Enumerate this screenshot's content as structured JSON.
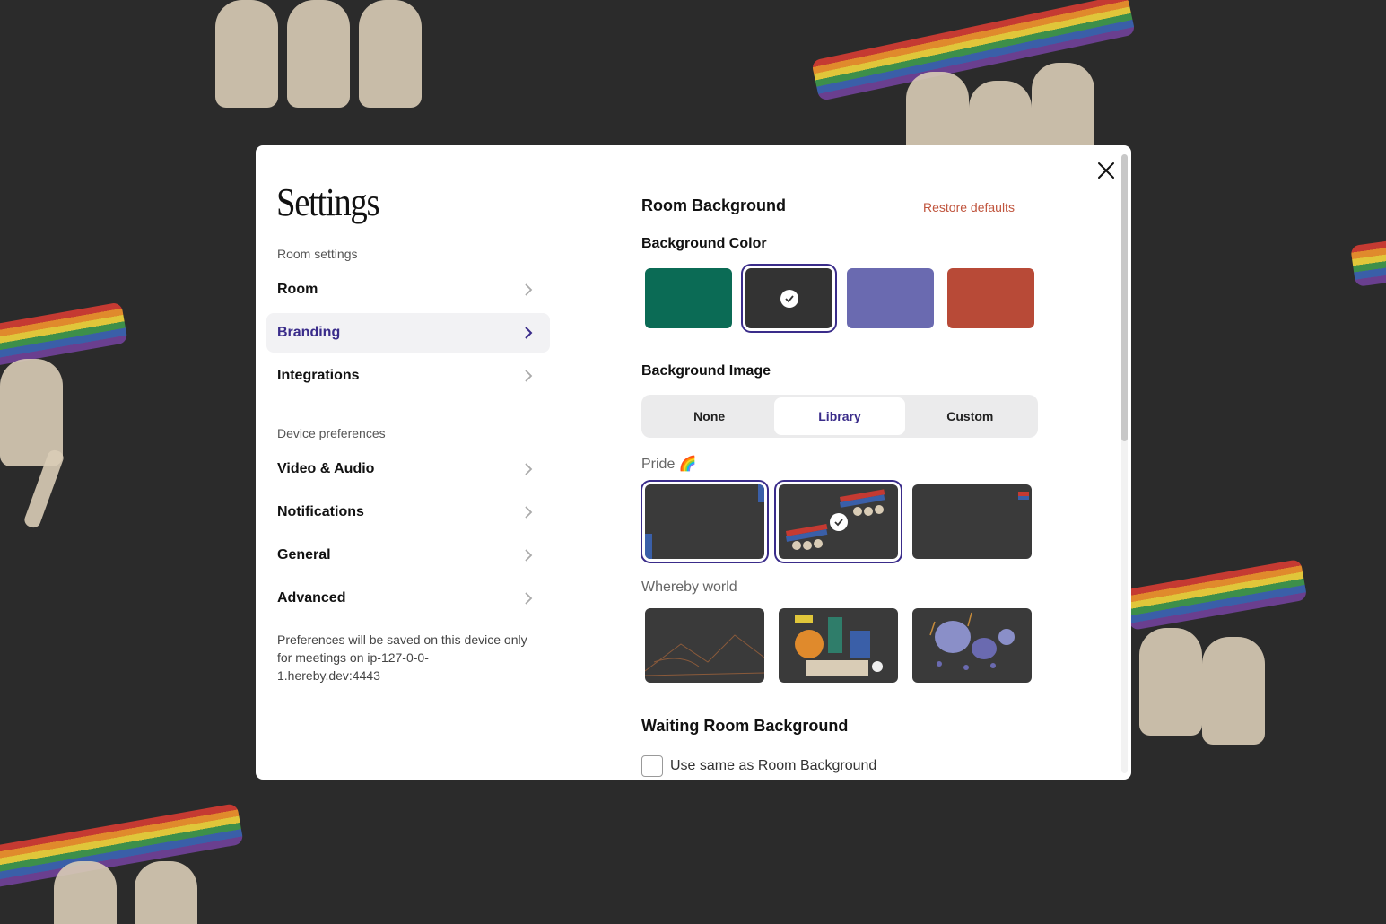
{
  "settings": {
    "title": "Settings",
    "room_settings_label": "Room settings",
    "device_prefs_label": "Device preferences",
    "nav": {
      "room": "Room",
      "branding": "Branding",
      "integrations": "Integrations",
      "video_audio": "Video & Audio",
      "notifications": "Notifications",
      "general": "General",
      "advanced": "Advanced"
    },
    "note": "Preferences will be saved on this device only for meetings on ip-127-0-0-1.hereby.dev:4443"
  },
  "branding": {
    "room_background_title": "Room Background",
    "restore_defaults": "Restore defaults",
    "background_color_title": "Background Color",
    "colors": [
      "#0b6b55",
      "#333333",
      "#6a6ab0",
      "#b84a37"
    ],
    "selected_color_index": 1,
    "background_image_title": "Background Image",
    "image_options": {
      "none": "None",
      "library": "Library",
      "custom": "Custom"
    },
    "selected_image_option": "Library",
    "group_pride": "Pride 🌈",
    "group_whereby": "Whereby world",
    "waiting_room_title": "Waiting Room Background",
    "same_as_room_label": "Use same as Room Background",
    "same_as_room_checked": false
  }
}
